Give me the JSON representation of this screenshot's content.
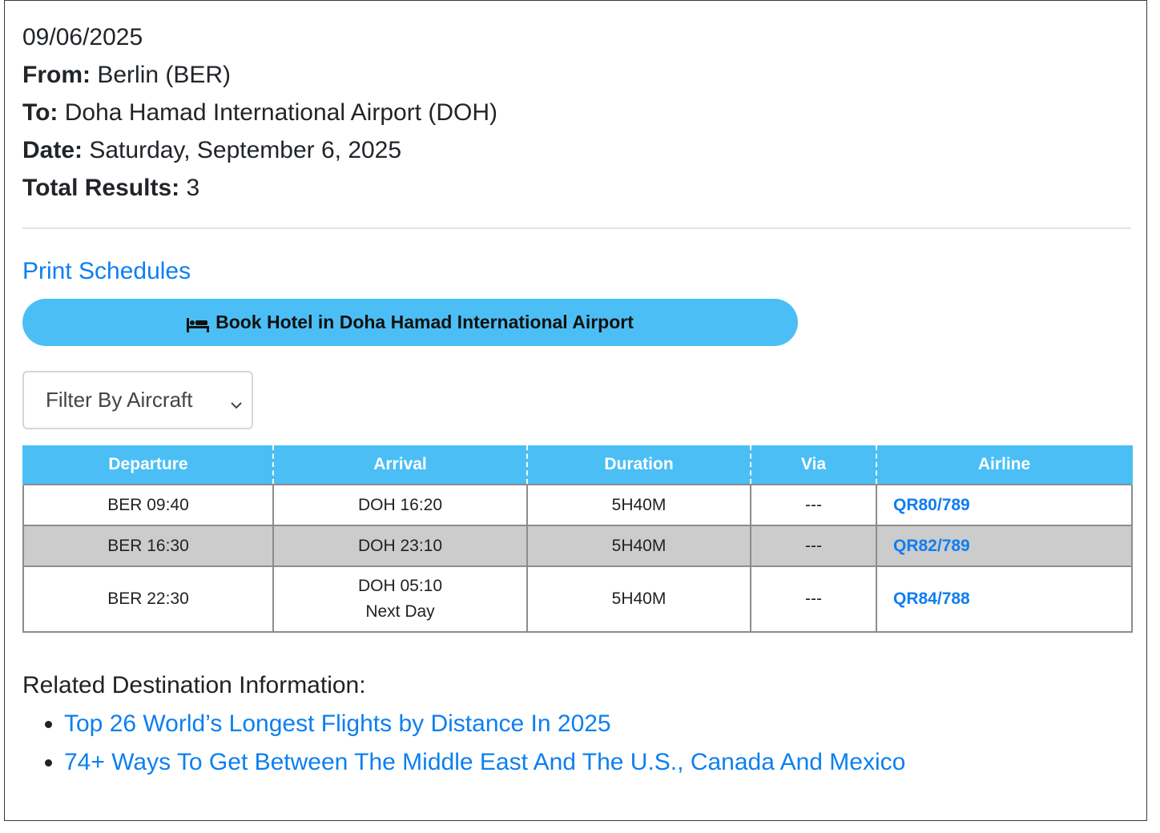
{
  "header": {
    "date_short": "09/06/2025",
    "from_label": "From:",
    "from_value": "Berlin (BER)",
    "to_label": "To:",
    "to_value": "Doha Hamad International Airport (DOH)",
    "date_label": "Date:",
    "date_value": "Saturday, September 6, 2025",
    "results_label": "Total Results:",
    "results_value": "3"
  },
  "actions": {
    "print_label": "Print Schedules",
    "hotel_label": "Book Hotel in Doha Hamad International Airport",
    "hotel_icon": "bed-icon",
    "filter_label": "Filter By Aircraft"
  },
  "table": {
    "headers": [
      "Departure",
      "Arrival",
      "Duration",
      "Via",
      "Airline"
    ],
    "rows": [
      {
        "departure": "BER 09:40",
        "arrival": "DOH 16:20",
        "arrival_note": "",
        "duration": "5H40M",
        "via": "---",
        "airline": "QR80/789"
      },
      {
        "departure": "BER 16:30",
        "arrival": "DOH 23:10",
        "arrival_note": "",
        "duration": "5H40M",
        "via": "---",
        "airline": "QR82/789"
      },
      {
        "departure": "BER 22:30",
        "arrival": "DOH 05:10",
        "arrival_note": "Next Day",
        "duration": "5H40M",
        "via": "---",
        "airline": "QR84/788"
      }
    ]
  },
  "related": {
    "title": "Related Destination Information:",
    "links": [
      "Top 26 World’s Longest Flights by Distance In 2025",
      "74+ Ways To Get Between The Middle East And The U.S., Canada And Mexico"
    ]
  },
  "colors": {
    "accent": "#4bbff5",
    "link": "#0d7ff0",
    "shaded_row": "#cccccc"
  }
}
